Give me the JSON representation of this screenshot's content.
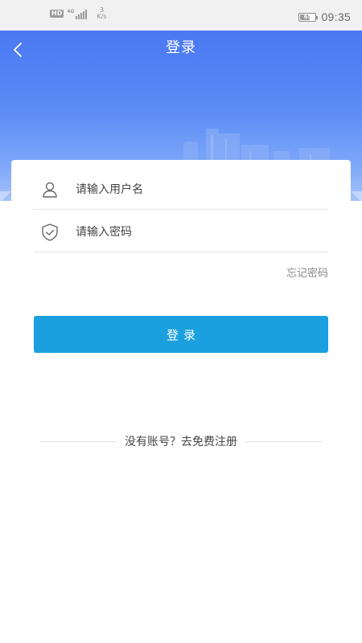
{
  "status_bar": {
    "hd_badge": "HD",
    "network_label": "4G",
    "speed_value": "3",
    "speed_unit": "K/s",
    "battery_level": "65",
    "battery_percent": 65,
    "time": "09:35"
  },
  "header": {
    "title": "登录",
    "back_icon": "chevron-left-icon",
    "background_top": "#4a78f2",
    "background_bottom": "#a7c3fa"
  },
  "form": {
    "username": {
      "placeholder": "请输入用户名",
      "value": "",
      "icon": "user-icon"
    },
    "password": {
      "placeholder": "请输入密码",
      "value": "",
      "icon": "shield-check-icon"
    },
    "forgot_label": "忘记密码"
  },
  "login_button": {
    "label": "登录",
    "color": "#1aa0de"
  },
  "register": {
    "prompt": "没有账号？",
    "link": "去免费注册"
  }
}
